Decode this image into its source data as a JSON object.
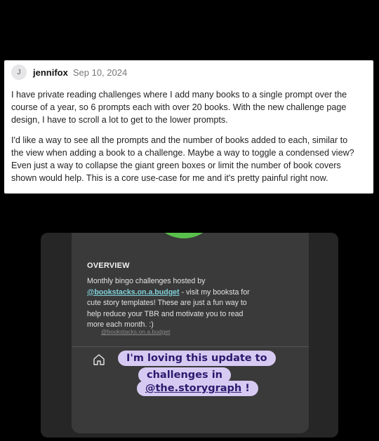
{
  "comment": {
    "avatar_letter": "J",
    "username": "jennifox",
    "date": "Sep 10, 2024",
    "paragraphs": [
      "I have private reading challenges where I add many books to a single prompt over the course of a year, so 6 prompts each with over 20 books. With the new challenge page design, I have to scroll a lot to get to the lower prompts.",
      "I'd like a way to see all the prompts and the number of books added to each, similar to the view when adding a book to a challenge. Maybe a way to toggle a condensed view? Even just a way to collapse the giant green boxes or limit the number of book covers shown would help. This is a core use-case for me and it's pretty painful right now."
    ]
  },
  "screenshot": {
    "overview_title": "OVERVIEW",
    "overview_intro": "Monthly bingo challenges hosted by",
    "overview_handle": "@bookstacks.on.a.budget",
    "overview_rest": " - visit my booksta for cute story templates! These are just a fun way to help reduce your TBR and motivate you to read more each month. :)",
    "faint_handle": "@bookstacks.on.a.budget",
    "home_icon": "home-icon",
    "sticker_line1": "I'm loving this update to",
    "sticker_line2": "challenges in",
    "sticker_handle": "@the.storygraph",
    "sticker_end": " !"
  },
  "colors": {
    "accent_green": "#59c04b",
    "sticker_bg": "#d7caf2",
    "sticker_text": "#2b1a6e",
    "link": "#7fd0d8"
  }
}
